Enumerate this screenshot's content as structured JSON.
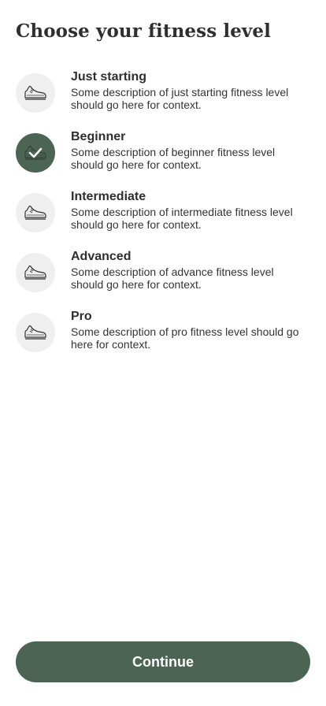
{
  "page": {
    "title": "Choose your fitness level"
  },
  "levels": [
    {
      "name": "Just starting",
      "description": "Some description of just starting fitness level should go here for context.",
      "icon": "sneaker-icon",
      "selected": false
    },
    {
      "name": "Beginner",
      "description": "Some description of beginner fitness level should go here for context.",
      "icon": "sneaker-icon",
      "selected": true
    },
    {
      "name": "Intermediate",
      "description": "Some description of intermediate fitness level should go here for context.",
      "icon": "sneaker-icon",
      "selected": false
    },
    {
      "name": "Advanced",
      "description": "Some description of advance fitness level should go here for context.",
      "icon": "sneaker-icon",
      "selected": false
    },
    {
      "name": "Pro",
      "description": "Some description of pro fitness level  should go here for context.",
      "icon": "sneaker-icon",
      "selected": false
    }
  ],
  "actions": {
    "continue_label": "Continue"
  },
  "colors": {
    "accent": "#4b6453",
    "icon_background": "#efefef",
    "text": "#2e2e2e"
  }
}
